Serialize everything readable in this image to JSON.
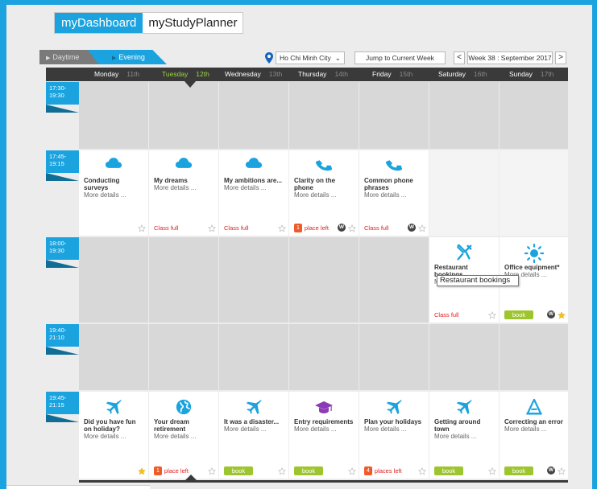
{
  "nav": {
    "active": "myDashboard",
    "other": "myStudyPlanner"
  },
  "day_tabs": {
    "daytime": "Daytime",
    "evening": "Evening"
  },
  "location": {
    "city": "Ho Chi Minh City"
  },
  "controls": {
    "jump": "Jump to Current Week",
    "prev": "<",
    "next": ">",
    "week": "Week 38 : September 2017"
  },
  "days": [
    {
      "name": "Monday",
      "num": "11th"
    },
    {
      "name": "Tuesday",
      "num": "12th",
      "today": true
    },
    {
      "name": "Wednesday",
      "num": "13th"
    },
    {
      "name": "Thursday",
      "num": "14th"
    },
    {
      "name": "Friday",
      "num": "15th"
    },
    {
      "name": "Saturday",
      "num": "16th"
    },
    {
      "name": "Sunday",
      "num": "17th"
    }
  ],
  "slots": [
    {
      "time": "17:30-\n19:30",
      "label_a": "17:30-",
      "label_b": "19:30"
    },
    {
      "time": "17:45-\n19:15",
      "label_a": "17:45-",
      "label_b": "19:15"
    },
    {
      "time": "18:00-\n19:30",
      "label_a": "18:00-",
      "label_b": "19:30"
    },
    {
      "time": "19:40-\n21:10",
      "label_a": "19:40-",
      "label_b": "21:10"
    },
    {
      "time": "19:45-\n21:15",
      "label_a": "19:45-",
      "label_b": "21:15"
    }
  ],
  "more_details": "More details ...",
  "class_full": "Class full",
  "book": "book",
  "row2": [
    {
      "title": "Conducting surveys",
      "icon": "cloud-icon"
    },
    {
      "title": "My dreams",
      "icon": "cloud-icon",
      "status": "Class full"
    },
    {
      "title": "My ambitions are...",
      "icon": "cloud-icon",
      "status": "Class full"
    },
    {
      "title": "Clarity on the phone",
      "icon": "phone-icon",
      "badge": "1",
      "status": "place left"
    },
    {
      "title": "Common phone phrases",
      "icon": "phone-icon",
      "status": "Class full"
    }
  ],
  "row3": [
    {
      "title": "Restaurant bookings",
      "icon": "utensils-icon",
      "status": "Class full"
    },
    {
      "title": "Office equipment*",
      "icon": "sun-icon",
      "status": "book"
    }
  ],
  "tooltip": "Restaurant bookings",
  "row5": [
    {
      "title": "Did you have fun on holiday?",
      "icon": "plane-icon"
    },
    {
      "title": "Your dream retirement",
      "icon": "globe-icon",
      "badge": "1",
      "status": "place left"
    },
    {
      "title": "It was a disaster...",
      "icon": "plane-icon",
      "status": "book"
    },
    {
      "title": "Entry requirements",
      "icon": "graduation-cap-icon",
      "status": "book"
    },
    {
      "title": "Plan your holidays",
      "icon": "plane-icon",
      "badge": "4",
      "status": "places left"
    },
    {
      "title": "Getting around town",
      "icon": "plane-icon",
      "status": "book"
    },
    {
      "title": "Correcting an error",
      "icon": "warning-icon",
      "status": "book"
    }
  ],
  "w_badge": "W",
  "colors": {
    "accent": "#1aa3df",
    "today": "#9fd83b",
    "book": "#9dc52d",
    "alert": "#e02020"
  }
}
